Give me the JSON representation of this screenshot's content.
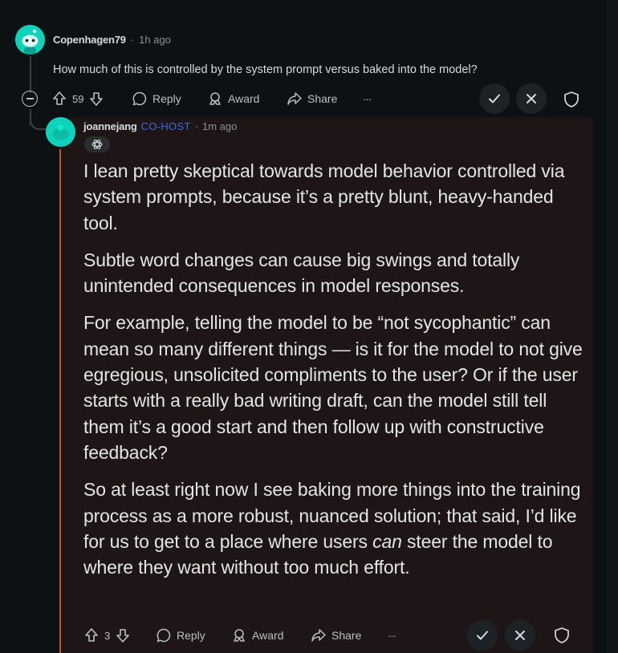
{
  "parent": {
    "username": "Copenhagen79",
    "separator": "·",
    "time": "1h ago",
    "body": "How much of this is controlled by the system prompt versus baked into the model?",
    "score": "59",
    "actions": {
      "reply": "Reply",
      "award": "Award",
      "share": "Share",
      "more": "···"
    }
  },
  "reply": {
    "username": "joannejang",
    "flair": "CO-HOST",
    "separator": "·",
    "time": "1m ago",
    "paragraphs": [
      "I lean pretty skeptical towards model behavior controlled via system prompts, because it’s a pretty blunt, heavy-handed tool.",
      "Subtle word changes can cause big swings and totally unintended consequences in model responses.",
      "For example, telling the model to be “not sycophantic” can mean so many different things — is it for the model to not give egregious, unsolicited compliments to the user? Or if the user starts with a really bad writing draft, can the model still tell them it’s a good start and then follow up with constructive feedback?"
    ],
    "last_paragraph": {
      "part1": "So at least right now I see baking more things into the training process as a more robust, nuanced solution; that said, I’d like for us to get to a place where users ",
      "emphasis": "can",
      "part2": " steer the model to where they want without too much effort."
    },
    "score": "3",
    "actions": {
      "reply": "Reply",
      "award": "Award",
      "share": "Share",
      "more": "···"
    }
  },
  "colors": {
    "background": "#0e1113",
    "reply_background": "#1e1616",
    "accent_line": "#c0552a",
    "flair": "#3d6bd6",
    "avatar": "#0dd3bb"
  }
}
